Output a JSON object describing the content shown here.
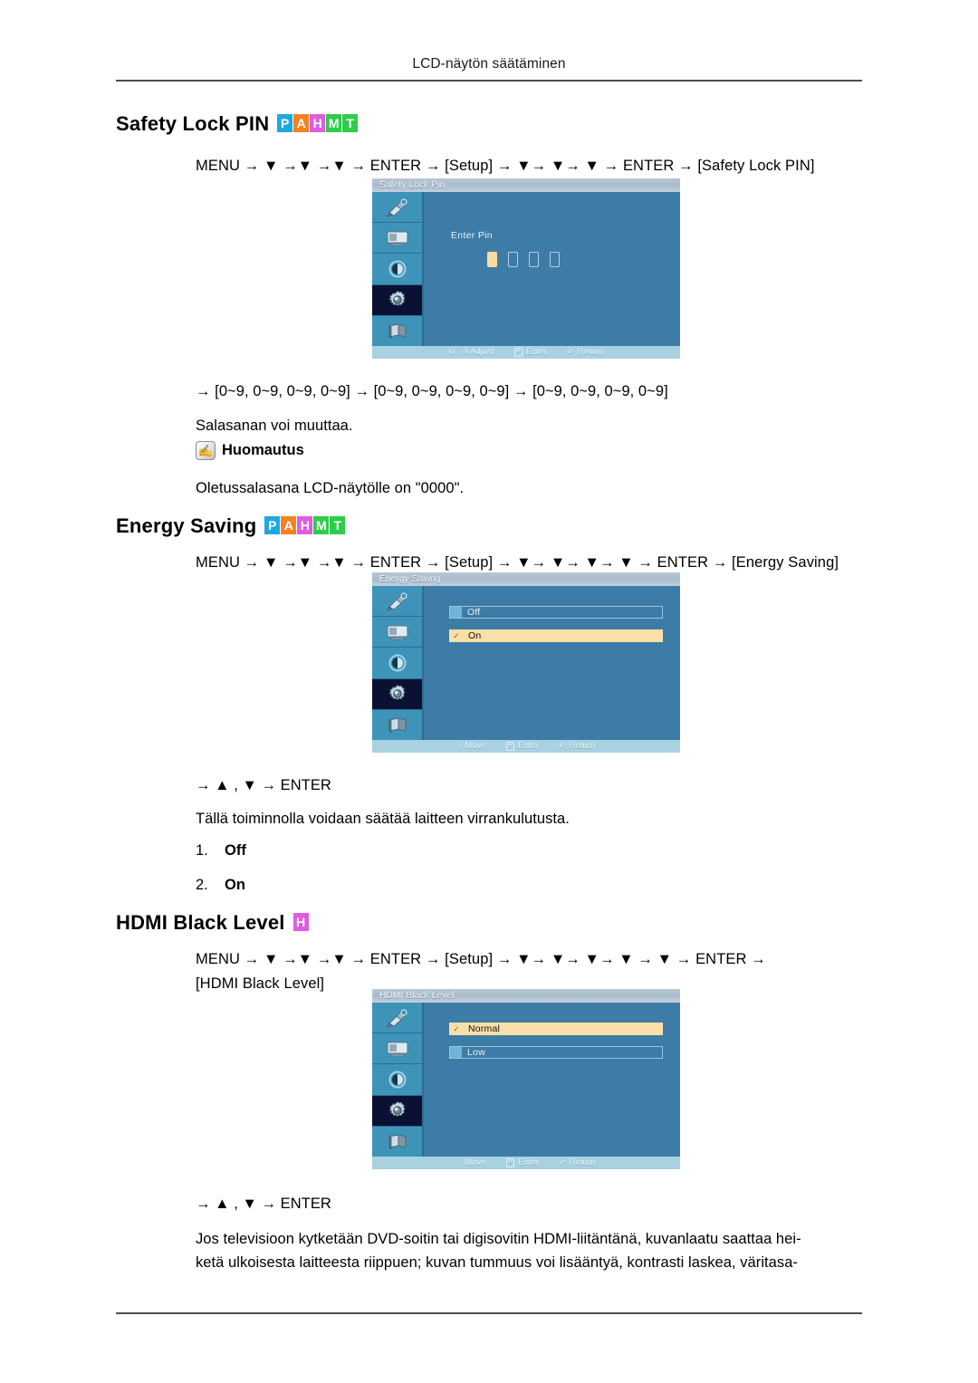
{
  "header": {
    "running_title": "LCD-näytön säätäminen"
  },
  "sections": [
    {
      "id": "safety-lock-pin",
      "title": "Safety Lock PIN",
      "badges": [
        {
          "letter": "P",
          "color": "#1fa8e0"
        },
        {
          "letter": "A",
          "color": "#f58220"
        },
        {
          "letter": "H",
          "color": "#e05ce0"
        },
        {
          "letter": "M",
          "color": "#2fcc4a"
        },
        {
          "letter": "T",
          "color": "#2fcc4a"
        }
      ],
      "nav_path": "MENU → ▼ →▼ →▼ → ENTER → [Setup] → ▼→ ▼→ ▼ → ENTER → [Safety Lock PIN]",
      "osd": {
        "title": "Safety Lock Pin",
        "pin_label": "Enter  Pin",
        "pin_boxes": [
          "filled",
          "empty",
          "empty",
          "empty"
        ],
        "footer": [
          {
            "glyph": "",
            "label": "0 .. 9  Adjust"
          },
          {
            "glyph": "enter",
            "label": "Enter"
          },
          {
            "glyph": "return",
            "label": "Return"
          }
        ]
      },
      "after_osd": {
        "range_line": "→ [0~9, 0~9, 0~9, 0~9] → [0~9, 0~9, 0~9, 0~9] → [0~9, 0~9, 0~9, 0~9]",
        "paragraph": "Salasanan voi muuttaa.",
        "note_label": "Huomautus",
        "note_body": "Oletussalasana LCD-näytölle on \"0000\"."
      }
    },
    {
      "id": "energy-saving",
      "title": "Energy Saving",
      "badges": [
        {
          "letter": "P",
          "color": "#1fa8e0"
        },
        {
          "letter": "A",
          "color": "#f58220"
        },
        {
          "letter": "H",
          "color": "#e05ce0"
        },
        {
          "letter": "M",
          "color": "#2fcc4a"
        },
        {
          "letter": "T",
          "color": "#2fcc4a"
        }
      ],
      "nav_path": "MENU → ▼ →▼ →▼ → ENTER → [Setup] → ▼→ ▼→ ▼→ ▼ → ENTER → [Energy Saving]",
      "osd": {
        "title": "Energy Saving",
        "options": [
          {
            "label": "Off",
            "selected": false
          },
          {
            "label": "On",
            "selected": true
          }
        ],
        "footer": [
          {
            "glyph": "move",
            "label": "Move"
          },
          {
            "glyph": "enter",
            "label": "Enter"
          },
          {
            "glyph": "return",
            "label": "Return"
          }
        ]
      },
      "after_osd": {
        "key_line": "→ ▲ , ▼ → ENTER",
        "paragraph": "Tällä toiminnolla voidaan säätää laitteen virrankulutusta.",
        "list": [
          {
            "num": "1.",
            "value": "Off"
          },
          {
            "num": "2.",
            "value": "On"
          }
        ]
      }
    },
    {
      "id": "hdmi-black-level",
      "title": "HDMI Black Level",
      "badges": [
        {
          "letter": "H",
          "color": "#e05ce0"
        }
      ],
      "nav_path_line1": "MENU → ▼ →▼ →▼ → ENTER → [Setup] → ▼→ ▼→ ▼→ ▼ → ▼ → ENTER →",
      "nav_path_line2": "[HDMI Black Level]",
      "osd": {
        "title": "HDMI Black Level",
        "options": [
          {
            "label": "Normal",
            "selected": true
          },
          {
            "label": "Low",
            "selected": false
          }
        ],
        "footer": [
          {
            "glyph": "move",
            "label": "Move"
          },
          {
            "glyph": "enter",
            "label": "Enter"
          },
          {
            "glyph": "return",
            "label": "Return"
          }
        ]
      },
      "after_osd": {
        "key_line": "→ ▲ , ▼ → ENTER",
        "paragraph_line1": "Jos televisioon kytketään DVD-soitin tai digisovitin HDMI-liitäntänä, kuvanlaatu saattaa hei-",
        "paragraph_line2": "ketä ulkoisesta laitteesta riippuen; kuvan tummuus voi lisääntyä, kontrasti laskea, väritasa-"
      }
    }
  ],
  "osd_colors": {
    "panel": "#3d7ca6",
    "sidebar": "#3e93b8",
    "active_icon": "#0b1133",
    "title_bar": "#b9c6d4",
    "footer_bar": "#a8d2e2",
    "highlight": "#fbdfa8",
    "marker": "#6eb4d8"
  }
}
